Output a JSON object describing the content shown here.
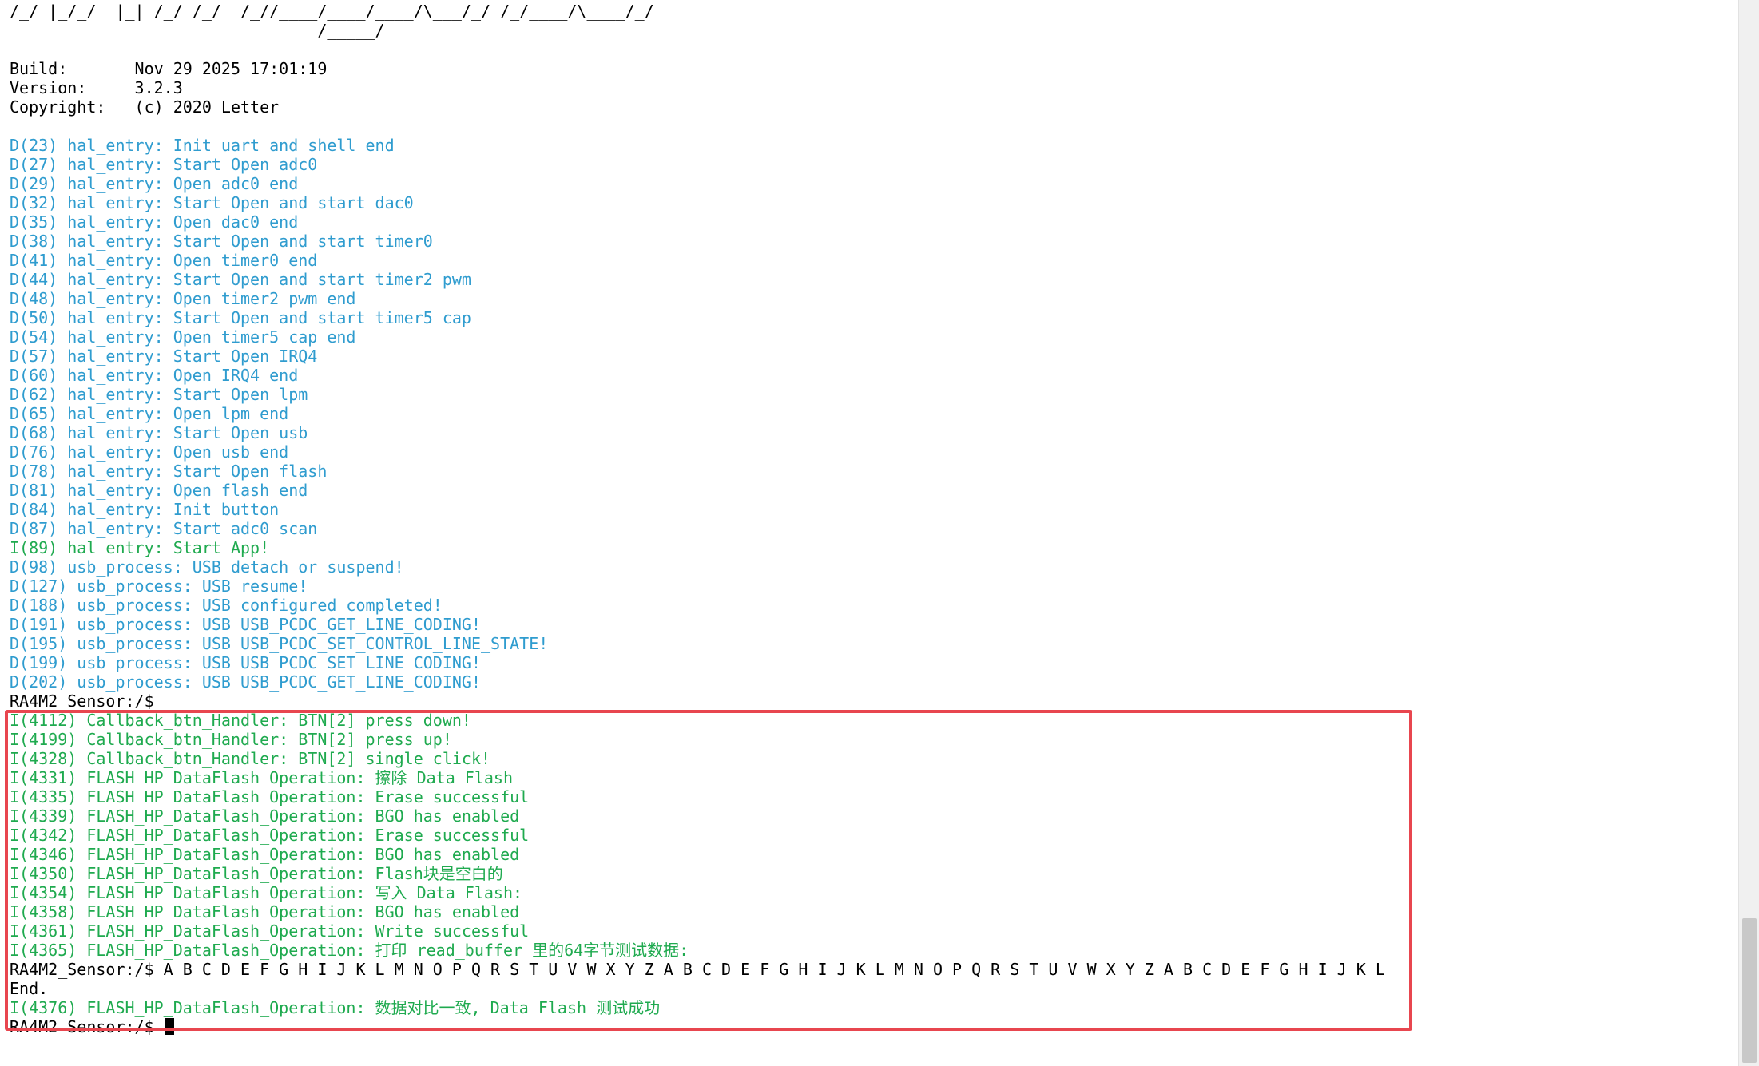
{
  "terminal": {
    "prompt": "RA4M2_Sensor:/$",
    "lines": [
      {
        "text": "/_/ |_/_/  |_| /_/ /_/  /_//____/____/____/\\___/_/ /_/____/\\____/_/",
        "color": "white"
      },
      {
        "text": "                                /_____/",
        "color": "white"
      },
      {
        "text": "",
        "color": "white"
      },
      {
        "text": "Build:       Nov 29 2025 17:01:19",
        "color": "white"
      },
      {
        "text": "Version:     3.2.3",
        "color": "white"
      },
      {
        "text": "Copyright:   (c) 2020 Letter",
        "color": "white"
      },
      {
        "text": "",
        "color": "white"
      },
      {
        "text": "D(23) hal_entry: Init uart and shell end",
        "color": "blue"
      },
      {
        "text": "D(27) hal_entry: Start Open adc0",
        "color": "blue"
      },
      {
        "text": "D(29) hal_entry: Open adc0 end",
        "color": "blue"
      },
      {
        "text": "D(32) hal_entry: Start Open and start dac0",
        "color": "blue"
      },
      {
        "text": "D(35) hal_entry: Open dac0 end",
        "color": "blue"
      },
      {
        "text": "D(38) hal_entry: Start Open and start timer0",
        "color": "blue"
      },
      {
        "text": "D(41) hal_entry: Open timer0 end",
        "color": "blue"
      },
      {
        "text": "D(44) hal_entry: Start Open and start timer2 pwm",
        "color": "blue"
      },
      {
        "text": "D(48) hal_entry: Open timer2 pwm end",
        "color": "blue"
      },
      {
        "text": "D(50) hal_entry: Start Open and start timer5 cap",
        "color": "blue"
      },
      {
        "text": "D(54) hal_entry: Open timer5 cap end",
        "color": "blue"
      },
      {
        "text": "D(57) hal_entry: Start Open IRQ4",
        "color": "blue"
      },
      {
        "text": "D(60) hal_entry: Open IRQ4 end",
        "color": "blue"
      },
      {
        "text": "D(62) hal_entry: Start Open lpm",
        "color": "blue"
      },
      {
        "text": "D(65) hal_entry: Open lpm end",
        "color": "blue"
      },
      {
        "text": "D(68) hal_entry: Start Open usb",
        "color": "blue"
      },
      {
        "text": "D(76) hal_entry: Open usb end",
        "color": "blue"
      },
      {
        "text": "D(78) hal_entry: Start Open flash",
        "color": "blue"
      },
      {
        "text": "D(81) hal_entry: Open flash end",
        "color": "blue"
      },
      {
        "text": "D(84) hal_entry: Init button",
        "color": "blue"
      },
      {
        "text": "D(87) hal_entry: Start adc0 scan",
        "color": "blue"
      },
      {
        "text": "I(89) hal_entry: Start App!",
        "color": "green"
      },
      {
        "text": "D(98) usb_process: USB detach or suspend!",
        "color": "blue"
      },
      {
        "text": "D(127) usb_process: USB resume!",
        "color": "blue"
      },
      {
        "text": "D(188) usb_process: USB configured completed!",
        "color": "blue"
      },
      {
        "text": "D(191) usb_process: USB USB_PCDC_GET_LINE_CODING!",
        "color": "blue"
      },
      {
        "text": "D(195) usb_process: USB USB_PCDC_SET_CONTROL_LINE_STATE!",
        "color": "blue"
      },
      {
        "text": "D(199) usb_process: USB USB_PCDC_SET_LINE_CODING!",
        "color": "blue"
      },
      {
        "text": "D(202) usb_process: USB USB_PCDC_GET_LINE_CODING!",
        "color": "blue"
      },
      {
        "text": "RA4M2_Sensor:/$",
        "color": "white"
      },
      {
        "text": "I(4112) Callback_btn_Handler: BTN[2] press down!",
        "color": "green"
      },
      {
        "text": "I(4199) Callback_btn_Handler: BTN[2] press up!",
        "color": "green"
      },
      {
        "text": "I(4328) Callback_btn_Handler: BTN[2] single click!",
        "color": "green"
      },
      {
        "text": "I(4331) FLASH_HP_DataFlash_Operation: 擦除 Data Flash",
        "color": "green"
      },
      {
        "text": "I(4335) FLASH_HP_DataFlash_Operation: Erase successful",
        "color": "green"
      },
      {
        "text": "I(4339) FLASH_HP_DataFlash_Operation: BGO has enabled",
        "color": "green"
      },
      {
        "text": "I(4342) FLASH_HP_DataFlash_Operation: Erase successful",
        "color": "green"
      },
      {
        "text": "I(4346) FLASH_HP_DataFlash_Operation: BGO has enabled",
        "color": "green"
      },
      {
        "text": "I(4350) FLASH_HP_DataFlash_Operation: Flash块是空白的",
        "color": "green"
      },
      {
        "text": "I(4354) FLASH_HP_DataFlash_Operation: 写入 Data Flash:",
        "color": "green"
      },
      {
        "text": "I(4358) FLASH_HP_DataFlash_Operation: BGO has enabled",
        "color": "green"
      },
      {
        "text": "I(4361) FLASH_HP_DataFlash_Operation: Write successful",
        "color": "green"
      },
      {
        "text": "I(4365) FLASH_HP_DataFlash_Operation: 打印 read_buffer 里的64字节测试数据:",
        "color": "green"
      },
      {
        "text": "RA4M2_Sensor:/$ A B C D E F G H I J K L M N O P Q R S T U V W X Y Z A B C D E F G H I J K L M N O P Q R S T U V W X Y Z A B C D E F G H I J K L",
        "color": "white"
      },
      {
        "text": "End.",
        "color": "white"
      },
      {
        "text": "I(4376) FLASH_HP_DataFlash_Operation: 数据对比一致, Data Flash 测试成功",
        "color": "green"
      },
      {
        "text": "",
        "color": "white"
      }
    ]
  },
  "colors": {
    "background": "#ffffff",
    "white": "#000000",
    "blue": "#2f9ccf",
    "green": "#1faa4f",
    "highlight": "#e8464f"
  }
}
